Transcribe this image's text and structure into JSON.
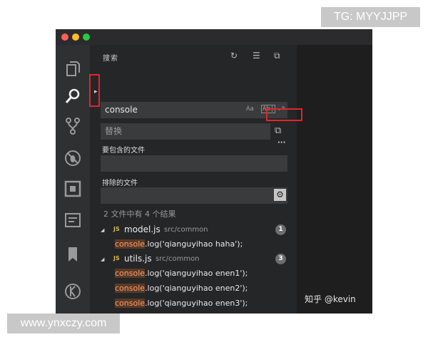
{
  "watermarks": {
    "top": "TG: MYYJJPP",
    "bottom": "www.ynxczy.com"
  },
  "panel": {
    "title": "搜索",
    "actions": [
      {
        "name": "refresh-icon",
        "glyph": "↻"
      },
      {
        "name": "clear-results-icon",
        "glyph": "☰"
      },
      {
        "name": "collapse-all-icon",
        "glyph": "⧉"
      }
    ]
  },
  "search": {
    "toggle_glyph": "▸",
    "value": "console",
    "options": [
      "Aa",
      "Ab|",
      ".*"
    ],
    "replace_placeholder": "替换",
    "replace_all_glyph": "⧉",
    "more_glyph": "···"
  },
  "include": {
    "label": "要包含的文件",
    "value": ""
  },
  "exclude": {
    "label": "排除的文件",
    "value": "",
    "toggle_glyph": "⚙"
  },
  "summary": "2 文件中有 4 个结果",
  "results": [
    {
      "file": "model.js",
      "path": "src/common",
      "count": "1",
      "matches": [
        {
          "term": "console",
          "rest": ".log('qianguyihao haha');"
        }
      ]
    },
    {
      "file": "utils.js",
      "path": "src/common",
      "count": "3",
      "matches": [
        {
          "term": "console",
          "rest": ".log('qianguyihao enen1');"
        },
        {
          "term": "console",
          "rest": ".log('qianguyihao enen2');"
        },
        {
          "term": "console",
          "rest": ".log('qianguyihao enen3');"
        }
      ]
    }
  ],
  "file_icon_text": "JS",
  "tree_glyph": "◢",
  "credit": "知乎 @kevin",
  "colors": {
    "highlight": "#ff9d6e",
    "annotation_red": "#e1252a"
  }
}
